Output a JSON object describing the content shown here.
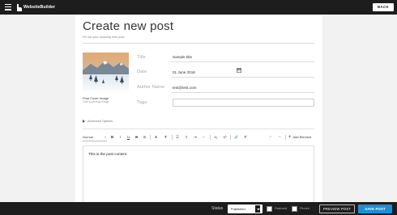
{
  "app": {
    "logo_text": "WebsiteBuilder"
  },
  "header": {
    "back_label": "BACK"
  },
  "page": {
    "title": "Create new post",
    "subtitle": "Fill out your amazing new post."
  },
  "cover": {
    "caption": "Post Cover Image",
    "hint": "Click to change image"
  },
  "fields": {
    "title_label": "Title",
    "title_value": "Sample title",
    "date_label": "Date",
    "date_value": "01 June 2018",
    "author_label": "Author Name",
    "author_value": "test@test.com",
    "tags_label": "Tags",
    "tags_value": ""
  },
  "advanced": {
    "label": "Advanced Options"
  },
  "toolbar": {
    "style_select": "Normal",
    "bold": "B",
    "italic": "I",
    "underline": "U",
    "strike": "S",
    "code": "⊘",
    "color": "A",
    "size": "T",
    "bullets": "☰",
    "numbers": "≡",
    "indent": "⇥",
    "outdent": "⇤",
    "subscript": "x₂",
    "superscript": "x²",
    "link": "🔗",
    "clear": "T̸",
    "undo": "↶",
    "redo": "↷",
    "add_element": "Add Element"
  },
  "editor": {
    "content": "This is the post content"
  },
  "footer": {
    "status_label": "Status",
    "status_value": "Published",
    "featured_label": "Featured",
    "pinned_label": "Pinned",
    "preview_label": "PREVIEW POST",
    "save_label": "SAVE POST"
  },
  "colors": {
    "accent": "#1b8fd6",
    "bar": "#1d1d1d"
  }
}
